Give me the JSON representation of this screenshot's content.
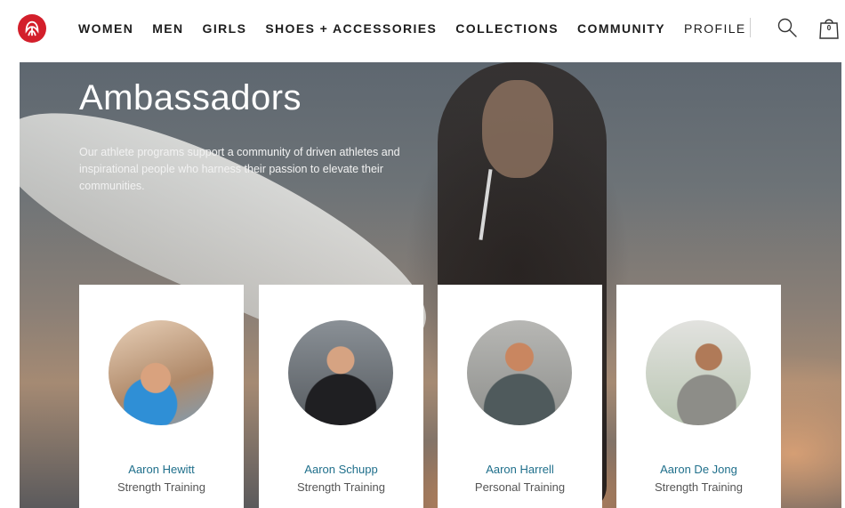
{
  "brand": {
    "accent": "#d31f2b",
    "logo_icon": "lululemon-logo-icon"
  },
  "nav": {
    "items": [
      "WOMEN",
      "MEN",
      "GIRLS",
      "SHOES + ACCESSORIES",
      "COLLECTIONS",
      "COMMUNITY"
    ],
    "profile": "PROFILE",
    "search_icon": "search-icon",
    "bag_icon": "shopping-bag-icon",
    "bag_count": "0"
  },
  "hero": {
    "title": "Ambassadors",
    "description": "Our athlete programs support a community of driven athletes and inspirational people who harness their passion to elevate their communities."
  },
  "ambassadors": [
    {
      "name": "Aaron Hewitt",
      "role": "Strength Training"
    },
    {
      "name": "Aaron Schupp",
      "role": "Strength Training"
    },
    {
      "name": "Aaron Harrell",
      "role": "Personal Training"
    },
    {
      "name": "Aaron De Jong",
      "role": "Strength Training"
    }
  ],
  "colors": {
    "name_link": "#1f6f8b",
    "role_text": "#555555"
  }
}
